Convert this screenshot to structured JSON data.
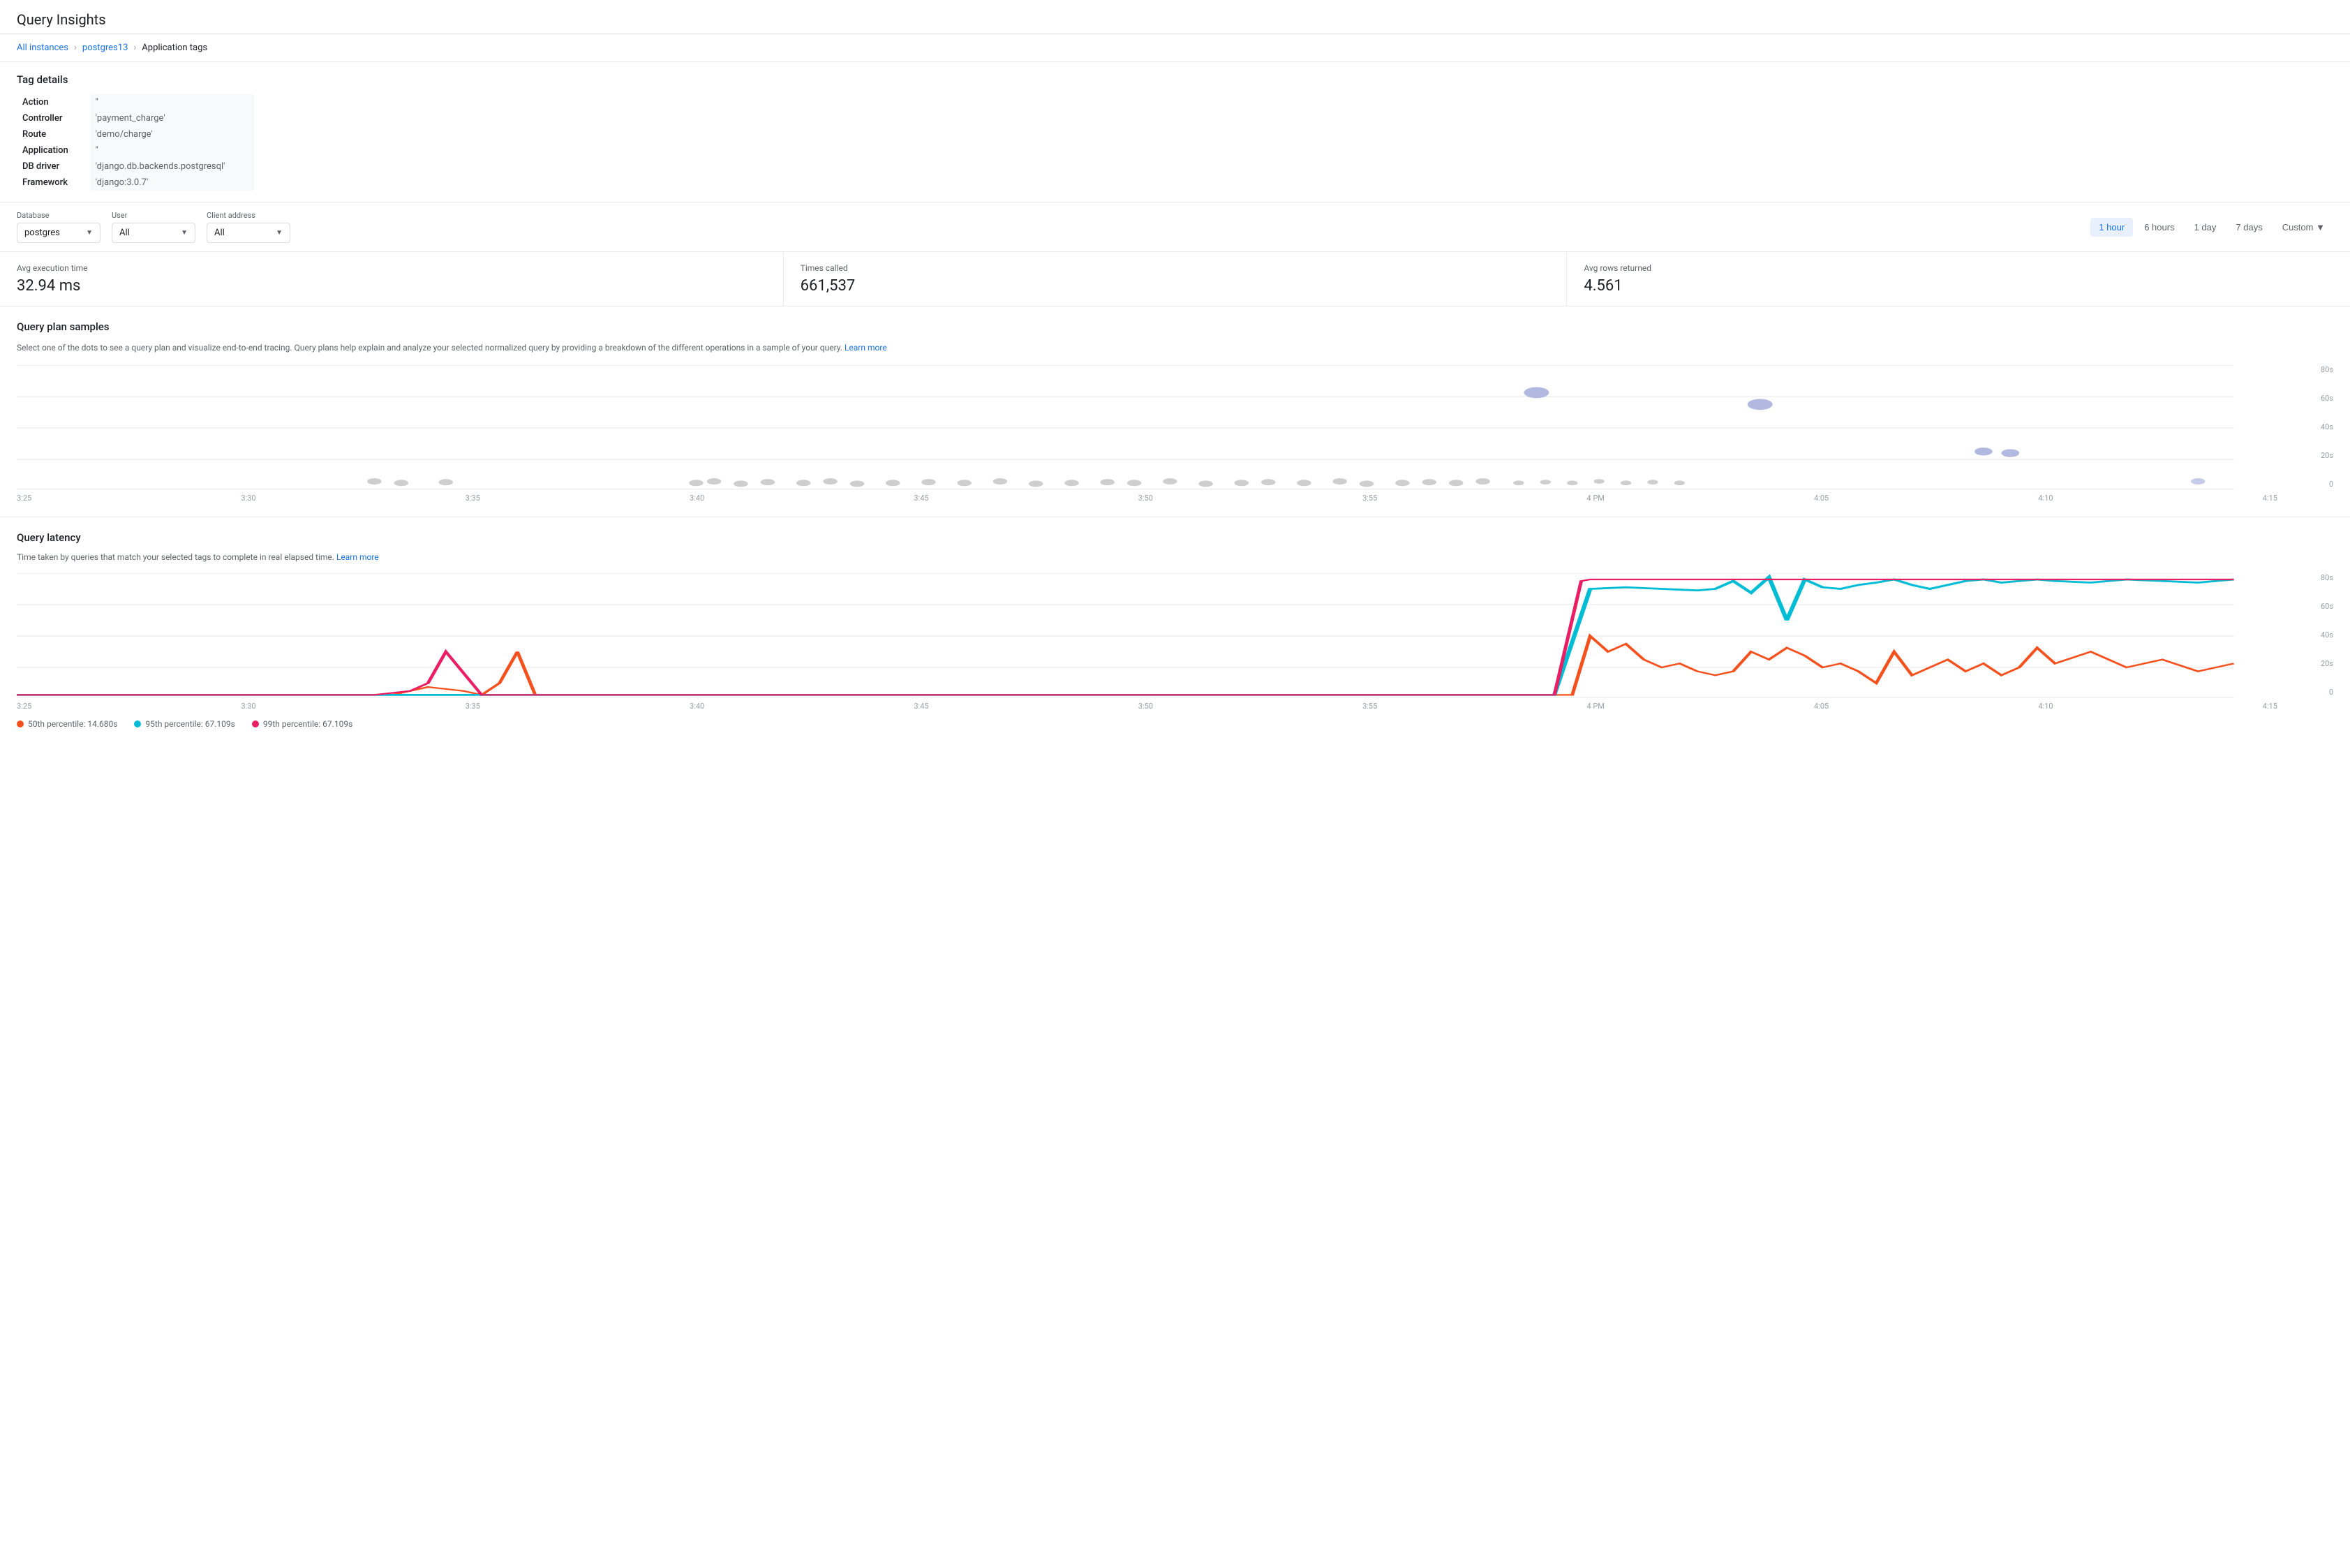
{
  "page": {
    "title": "Query Insights"
  },
  "breadcrumb": {
    "items": [
      "All instances",
      "postgres13",
      "Application tags"
    ]
  },
  "tag_details": {
    "title": "Tag details",
    "rows": [
      {
        "label": "Action",
        "value": "''"
      },
      {
        "label": "Controller",
        "value": "'payment_charge'"
      },
      {
        "label": "Route",
        "value": "'demo/charge'"
      },
      {
        "label": "Application",
        "value": "''"
      },
      {
        "label": "DB driver",
        "value": "'django.db.backends.postgresql'"
      },
      {
        "label": "Framework",
        "value": "'django:3.0.7'"
      }
    ]
  },
  "filters": {
    "database": {
      "label": "Database",
      "value": "postgres"
    },
    "user": {
      "label": "User",
      "value": "All"
    },
    "client_address": {
      "label": "Client address",
      "value": "All"
    }
  },
  "time_buttons": {
    "buttons": [
      "1 hour",
      "6 hours",
      "1 day",
      "7 days"
    ],
    "active": "1 hour",
    "custom_label": "Custom"
  },
  "metrics": [
    {
      "label": "Avg execution time",
      "value": "32.94 ms"
    },
    {
      "label": "Times called",
      "value": "661,537"
    },
    {
      "label": "Avg rows returned",
      "value": "4.561"
    }
  ],
  "query_plan": {
    "title": "Query plan samples",
    "description": "Select one of the dots to see a query plan and visualize end-to-end tracing. Query plans help explain and analyze your selected normalized query by providing a breakdown of the different operations in a sample of your query.",
    "learn_more": "Learn more",
    "y_labels": [
      "80s",
      "60s",
      "40s",
      "20s",
      "0"
    ],
    "x_labels": [
      "3:25",
      "3:30",
      "3:35",
      "3:40",
      "3:45",
      "3:50",
      "3:55",
      "4 PM",
      "4:05",
      "4:10",
      "4:15"
    ]
  },
  "query_latency": {
    "title": "Query latency",
    "description": "Time taken by queries that match your selected tags to complete in real elapsed time.",
    "learn_more": "Learn more",
    "y_labels": [
      "80s",
      "60s",
      "40s",
      "20s",
      "0"
    ],
    "x_labels": [
      "3:25",
      "3:30",
      "3:35",
      "3:40",
      "3:45",
      "3:50",
      "3:55",
      "4 PM",
      "4:05",
      "4:10",
      "4:15"
    ],
    "legend": [
      {
        "label": "50th percentile: 14.680s",
        "color": "#f4511e"
      },
      {
        "label": "95th percentile: 67.109s",
        "color": "#00bcd4"
      },
      {
        "label": "99th percentile: 67.109s",
        "color": "#e91e63"
      }
    ]
  }
}
